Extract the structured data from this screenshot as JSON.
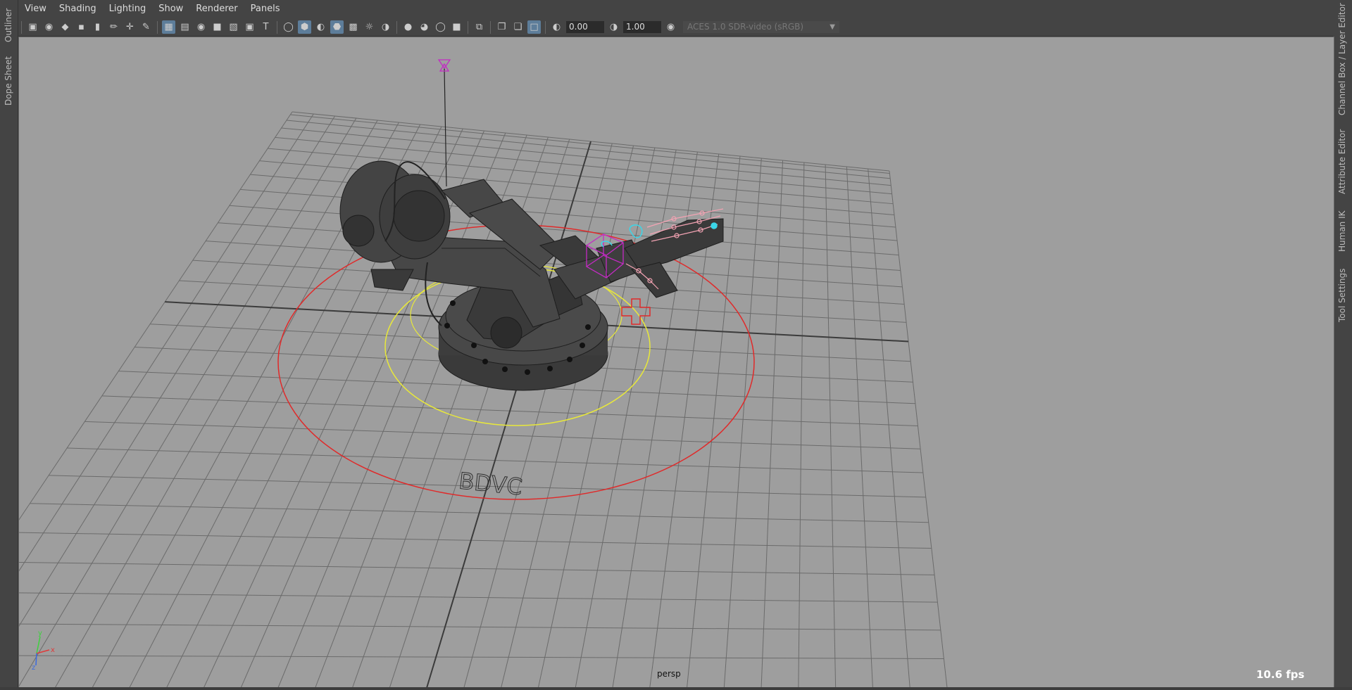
{
  "left_tabs": [
    "Outliner",
    "Dope Sheet"
  ],
  "right_tabs": [
    "Channel Box / Layer Editor",
    "Attribute Editor",
    "Human IK",
    "Tool Settings"
  ],
  "menu": [
    "View",
    "Shading",
    "Lighting",
    "Show",
    "Renderer",
    "Panels"
  ],
  "toolbar": {
    "exposure_value": "0.00",
    "gamma_value": "1.00",
    "color_space": "ACES 1.0 SDR-video (sRGB)"
  },
  "viewport": {
    "camera_name": "persp",
    "fps": "10.6 fps",
    "ground_text": "BDVC",
    "axis_x": "x",
    "axis_y": "y",
    "axis_z": "z"
  },
  "colors": {
    "viewport_bg": "#9e9e9e",
    "grid": "#6b6b6b",
    "red_control": "#e02a2a",
    "yellow_control": "#e8e83a",
    "magenta_control": "#c42ac4",
    "cyan_control": "#3ad6e8",
    "pink_joints": "#f3a3b3"
  }
}
